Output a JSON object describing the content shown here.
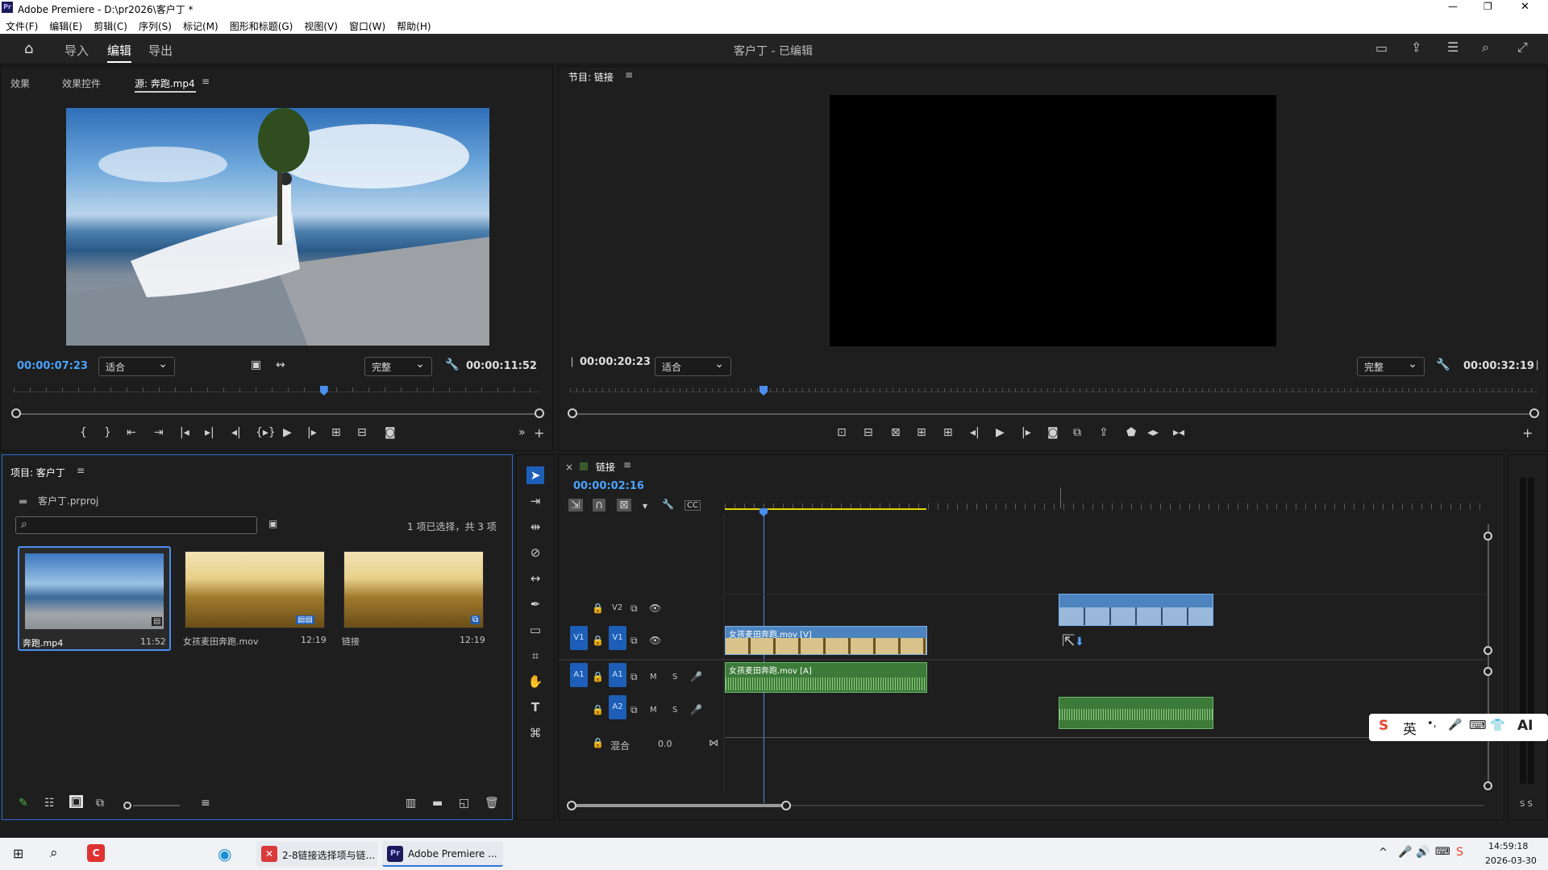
{
  "window": {
    "title": "Adobe Premiere - D:\\pr2026\\客户丁 *",
    "app_icon": "Pr",
    "controls": [
      "—",
      "❐",
      "✕"
    ]
  },
  "menu": [
    "文件(F)",
    "编辑(E)",
    "剪辑(C)",
    "序列(S)",
    "标记(M)",
    "图形和标题(G)",
    "视图(V)",
    "窗口(W)",
    "帮助(H)"
  ],
  "header": {
    "tabs": [
      "导入",
      "编辑",
      "导出"
    ],
    "active_tab": "编辑",
    "project_status": "客户丁 - 已编辑"
  },
  "source_monitor": {
    "tabs": [
      "效果",
      "效果控件",
      "源: 奔跑.mp4"
    ],
    "menu_icon": "≡",
    "timecode": "00:00:07:23",
    "fit": "适合",
    "quality": "完整",
    "duration": "00:00:11:52",
    "playhead_fraction": 0.59
  },
  "program_monitor": {
    "title": "节目: 链接",
    "menu_icon": "≡",
    "timecode": "00:00:20:23",
    "fit": "适合",
    "quality": "完整",
    "duration": "00:00:32:19",
    "playhead_fraction": 0.2
  },
  "project": {
    "title": "项目: 客户丁",
    "menu_icon": "≡",
    "file": "客户丁.prproj",
    "search_placeholder": "",
    "selection_info": "1 项已选择，共 3 项",
    "items": [
      {
        "name": "奔跑.mp4",
        "duration": "11:52",
        "selected": true
      },
      {
        "name": "女孩麦田奔跑.mov",
        "duration": "12:19",
        "selected": false
      },
      {
        "name": "链接",
        "duration": "12:19",
        "selected": false
      }
    ]
  },
  "timeline": {
    "sequence": "链接",
    "menu_icon": "≡",
    "close": "×",
    "timecode": "00:00:02:16",
    "tracks": {
      "video": [
        {
          "label": "V2"
        },
        {
          "label": "V1",
          "source": "V1"
        }
      ],
      "audio": [
        {
          "label": "A1",
          "source": "A1"
        },
        {
          "label": "A2"
        }
      ],
      "mix": {
        "label": "混合",
        "value": "0.0"
      }
    },
    "clips": {
      "v1": "女孩麦田奔跑.mov [V]",
      "a1": "女孩麦田奔跑.mov [A]"
    },
    "track_letters": {
      "mute": "M",
      "solo": "S"
    },
    "meter_label": "S S"
  },
  "ime": {
    "items": [
      "S",
      "英",
      "•,",
      "🎤",
      "⌨",
      "👕",
      "AI"
    ]
  },
  "taskbar": {
    "apps": [
      "2-8链接选择项与链...",
      "Adobe Premiere ..."
    ],
    "time": "14:59:18",
    "date": "2026-03-30"
  },
  "colors": {
    "accent_blue": "#1d5fb8",
    "timecode_blue": "#4aa3ff",
    "video_clip": "#5a9ad8",
    "audio_clip": "#3c7a3a",
    "in_out_yellow": "#e5d400"
  }
}
